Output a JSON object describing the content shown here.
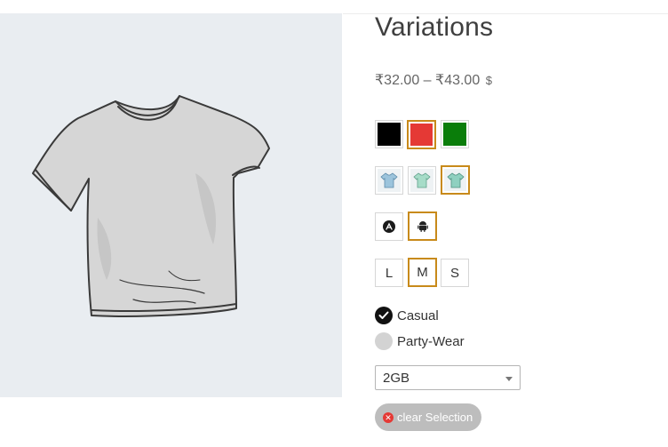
{
  "product": {
    "title": "Variations",
    "price_range": "₹32.00 – ₹43.00",
    "currency_suffix": "$"
  },
  "colors": {
    "black": "#000000",
    "red": "#e53935",
    "green": "#0a7d0a",
    "selected_border": "#c88a1a",
    "image_bg": "#e9edf1"
  },
  "color_swatches": [
    {
      "name": "black",
      "hex": "#000000",
      "selected": false
    },
    {
      "name": "red",
      "hex": "#e53935",
      "selected": true
    },
    {
      "name": "green",
      "hex": "#0a7d0a",
      "selected": false
    }
  ],
  "image_swatches": [
    {
      "name": "shirt-blue",
      "selected": false
    },
    {
      "name": "shirt-mint",
      "selected": false
    },
    {
      "name": "shirt-teal",
      "selected": true
    }
  ],
  "icon_swatches": [
    {
      "icon": "app-store-icon",
      "selected": false
    },
    {
      "icon": "android-icon",
      "selected": true
    }
  ],
  "sizes": [
    {
      "label": "L",
      "selected": false
    },
    {
      "label": "M",
      "selected": true
    },
    {
      "label": "S",
      "selected": false
    }
  ],
  "style_options": [
    {
      "label": "Casual",
      "checked": true
    },
    {
      "label": "Party-Wear",
      "checked": false
    }
  ],
  "memory_select": {
    "value": "2GB"
  },
  "clear_button": {
    "label": "clear Selection",
    "icon": "close-icon"
  }
}
